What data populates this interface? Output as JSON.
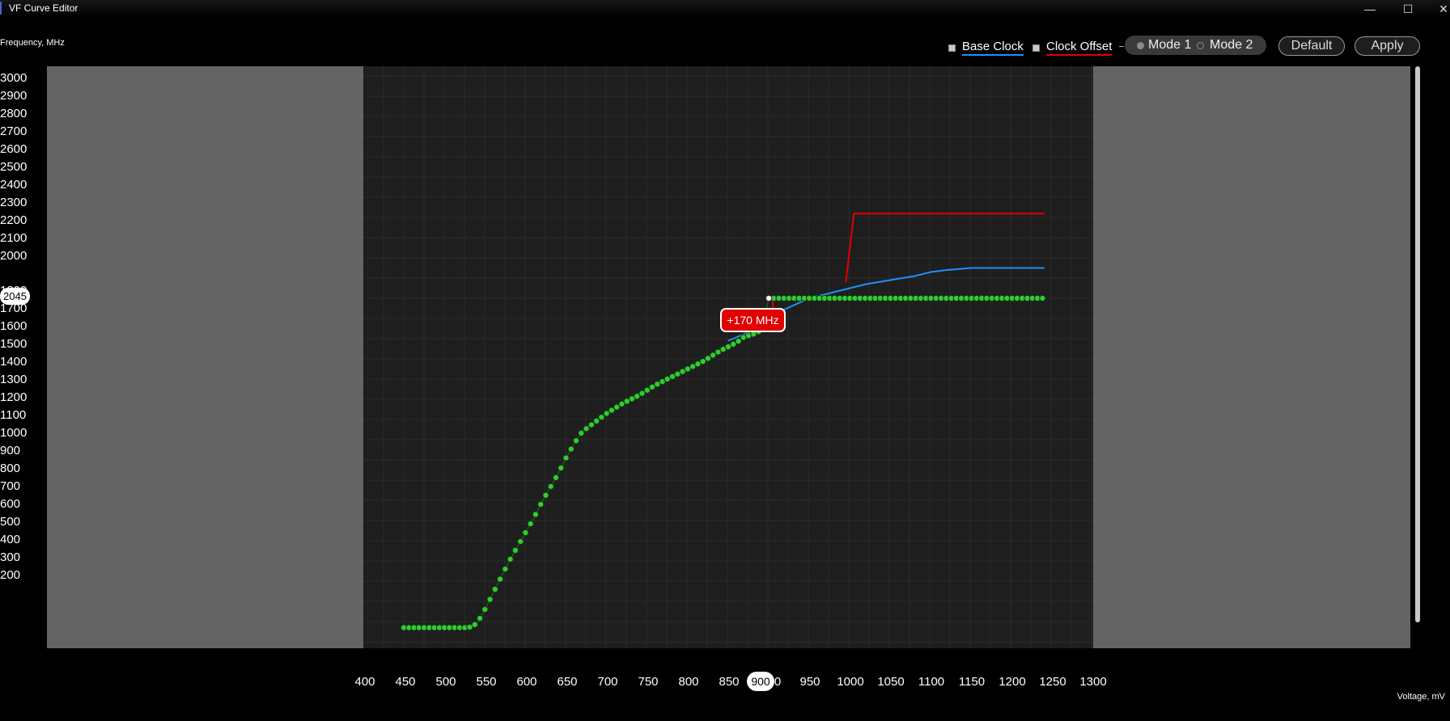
{
  "window": {
    "title": "VF Curve Editor",
    "minimize": "—",
    "maximize": "☐",
    "close": "✕"
  },
  "axes": {
    "y_title": "Frequency, MHz",
    "x_title": "Voltage, mV",
    "y_ticks": [
      "3000",
      "2900",
      "2800",
      "2700",
      "2600",
      "2500",
      "2400",
      "2300",
      "2200",
      "2100",
      "2000",
      "1800",
      "1700",
      "1600",
      "1500",
      "1400",
      "1300",
      "1200",
      "1100",
      "1000",
      "900",
      "800",
      "700",
      "600",
      "500",
      "400",
      "300",
      "200"
    ],
    "x_ticks": [
      "400",
      "450",
      "500",
      "550",
      "600",
      "650",
      "700",
      "750",
      "800",
      "850",
      "0",
      "950",
      "1000",
      "1050",
      "1100",
      "1150",
      "1200",
      "1250",
      "1300"
    ]
  },
  "legend": {
    "base_clock": "Base Clock",
    "clock_offset": "Clock Offset",
    "base_color": "#1e90ff",
    "offset_color": "#e00000"
  },
  "mode": {
    "mode1": "Mode 1",
    "mode2": "Mode 2",
    "selected": "Mode 1"
  },
  "buttons": {
    "default": "Default",
    "apply": "Apply"
  },
  "cursor": {
    "y_value": "2045",
    "x_value": "900",
    "offset_tooltip": "+170 MHz"
  },
  "chart_data": {
    "type": "line",
    "xlabel": "Voltage, mV",
    "ylabel": "Frequency, MHz",
    "xlim": [
      400,
      1300
    ],
    "ylim": [
      200,
      3000
    ],
    "grid": true,
    "series": [
      {
        "name": "Base Clock",
        "color": "#1e90ff",
        "x": [
          850,
          880,
          900,
          950,
          1000,
          1020,
          1050,
          1080,
          1100,
          1120,
          1150,
          1200,
          1240
        ],
        "y": [
          1670,
          1720,
          1790,
          1880,
          1930,
          1950,
          1970,
          1990,
          2010,
          2020,
          2030,
          2030,
          2030
        ]
      },
      {
        "name": "Clock Offset",
        "color": "#e00000",
        "x": [
          995,
          1005,
          1240
        ],
        "y": [
          1960,
          2300,
          2300
        ]
      },
      {
        "name": "Curve points",
        "color": "#37c837",
        "points": [
          [
            450,
            250
          ],
          [
            530,
            250
          ],
          [
            540,
            270
          ],
          [
            550,
            340
          ],
          [
            560,
            420
          ],
          [
            570,
            500
          ],
          [
            580,
            580
          ],
          [
            590,
            650
          ],
          [
            600,
            720
          ],
          [
            610,
            790
          ],
          [
            620,
            870
          ],
          [
            630,
            940
          ],
          [
            640,
            1010
          ],
          [
            650,
            1090
          ],
          [
            660,
            1160
          ],
          [
            670,
            1220
          ],
          [
            680,
            1250
          ],
          [
            690,
            1280
          ],
          [
            700,
            1310
          ],
          [
            720,
            1360
          ],
          [
            740,
            1400
          ],
          [
            760,
            1450
          ],
          [
            780,
            1490
          ],
          [
            800,
            1530
          ],
          [
            820,
            1570
          ],
          [
            840,
            1620
          ],
          [
            860,
            1660
          ],
          [
            870,
            1690
          ],
          [
            880,
            1700
          ],
          [
            890,
            1720
          ],
          [
            895,
            1790
          ],
          [
            900,
            1880
          ],
          [
            950,
            1880
          ],
          [
            1000,
            1880
          ],
          [
            1050,
            1880
          ],
          [
            1100,
            1880
          ],
          [
            1150,
            1880
          ],
          [
            1200,
            1880
          ],
          [
            1240,
            1880
          ]
        ]
      }
    ]
  }
}
